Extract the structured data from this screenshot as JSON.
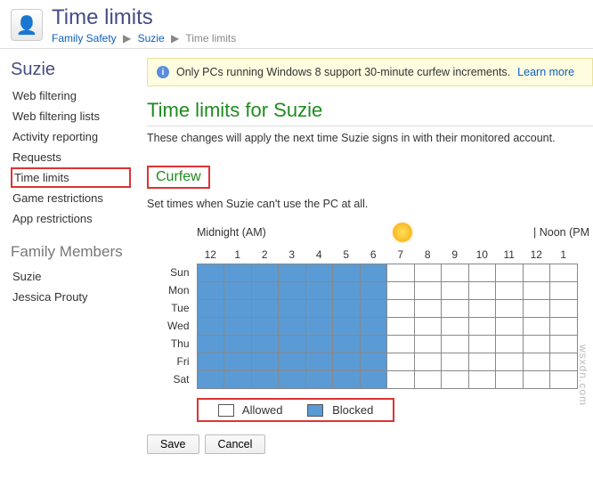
{
  "header": {
    "title": "Time limits",
    "breadcrumb": {
      "root": "Family Safety",
      "user": "Suzie",
      "leaf": "Time limits"
    }
  },
  "sidebar": {
    "user_title": "Suzie",
    "nav": [
      {
        "label": "Web filtering",
        "selected": false
      },
      {
        "label": "Web filtering lists",
        "selected": false
      },
      {
        "label": "Activity reporting",
        "selected": false
      },
      {
        "label": "Requests",
        "selected": false
      },
      {
        "label": "Time limits",
        "selected": true
      },
      {
        "label": "Game restrictions",
        "selected": false
      },
      {
        "label": "App restrictions",
        "selected": false
      }
    ],
    "family_heading": "Family Members",
    "family": [
      {
        "label": "Suzie"
      },
      {
        "label": "Jessica Prouty"
      }
    ]
  },
  "info": {
    "text": "Only PCs running Windows 8 support 30-minute curfew increments.",
    "link": "Learn more"
  },
  "page": {
    "heading": "Time limits for Suzie",
    "desc": "These changes will apply the next time Suzie signs in with their monitored account.",
    "section": "Curfew",
    "subdesc": "Set times when Suzie can't use the PC at all.",
    "axis_left": "Midnight (AM)",
    "axis_right": "| Noon (PM"
  },
  "chart_data": {
    "type": "heatmap",
    "hours": [
      "12",
      "1",
      "2",
      "3",
      "4",
      "5",
      "6",
      "7",
      "8",
      "9",
      "10",
      "11",
      "12",
      "1"
    ],
    "days": [
      "Sun",
      "Mon",
      "Tue",
      "Wed",
      "Thu",
      "Fri",
      "Sat"
    ],
    "blocked_until_hour_index": 7,
    "legend": {
      "allowed": "Allowed",
      "blocked": "Blocked"
    },
    "colors": {
      "blocked": "#5a9bd5",
      "allowed": "#ffffff"
    }
  },
  "buttons": {
    "save": "Save",
    "cancel": "Cancel"
  },
  "watermark": "wsxdn.com"
}
